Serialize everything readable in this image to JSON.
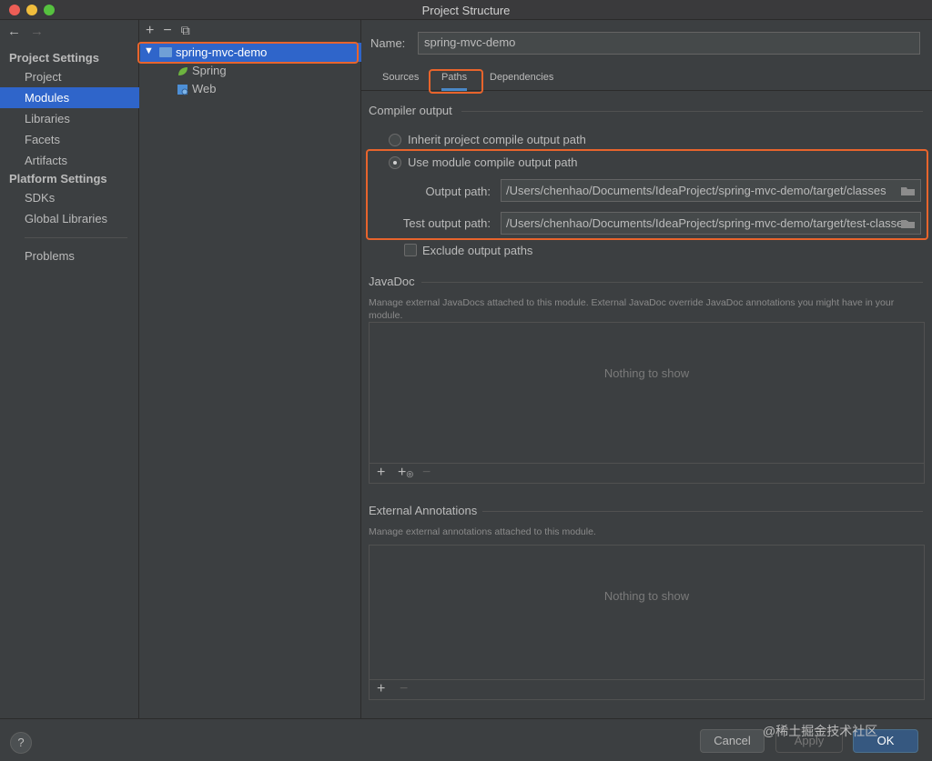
{
  "window": {
    "title": "Project Structure"
  },
  "sidebar": {
    "back_icon": "arrow-left-icon",
    "forward_icon": "arrow-right-icon",
    "project_settings_header": "Project Settings",
    "project_items": [
      "Project",
      "Modules",
      "Libraries",
      "Facets",
      "Artifacts"
    ],
    "selected": "Modules",
    "platform_settings_header": "Platform Settings",
    "platform_items": [
      "SDKs",
      "Global Libraries"
    ],
    "problems": "Problems"
  },
  "tree": {
    "toolbar": {
      "add": "+",
      "remove": "−",
      "copy": "⧉"
    },
    "root": "spring-mvc-demo",
    "children": [
      "Spring",
      "Web"
    ]
  },
  "module": {
    "name_label": "Name:",
    "name_value": "spring-mvc-demo",
    "tabs": [
      "Sources",
      "Paths",
      "Dependencies"
    ],
    "active_tab": "Paths"
  },
  "compiler_output": {
    "title": "Compiler output",
    "inherit_label": "Inherit project compile output path",
    "use_module_label": "Use module compile output path",
    "selected_option": "Use module compile output path",
    "output_path_label": "Output path:",
    "output_path": "/Users/chenhao/Documents/IdeaProject/spring-mvc-demo/target/classes",
    "test_output_path_label": "Test output path:",
    "test_output_path": "/Users/chenhao/Documents/IdeaProject/spring-mvc-demo/target/test-classes",
    "exclude_label": "Exclude output paths",
    "exclude_checked": false
  },
  "javadoc": {
    "title": "JavaDoc",
    "description": "Manage external JavaDocs attached to this module. External JavaDoc override JavaDoc annotations you might have in your module.",
    "empty": "Nothing to show"
  },
  "external_annotations": {
    "title": "External Annotations",
    "description": "Manage external annotations attached to this module.",
    "empty": "Nothing to show"
  },
  "buttons": {
    "help": "?",
    "cancel": "Cancel",
    "apply": "Apply",
    "ok": "OK"
  },
  "watermark": "@稀土掘金技术社区",
  "colors": {
    "selection": "#2f65ca",
    "highlight_box": "#e8642c",
    "background": "#3c3f41"
  }
}
